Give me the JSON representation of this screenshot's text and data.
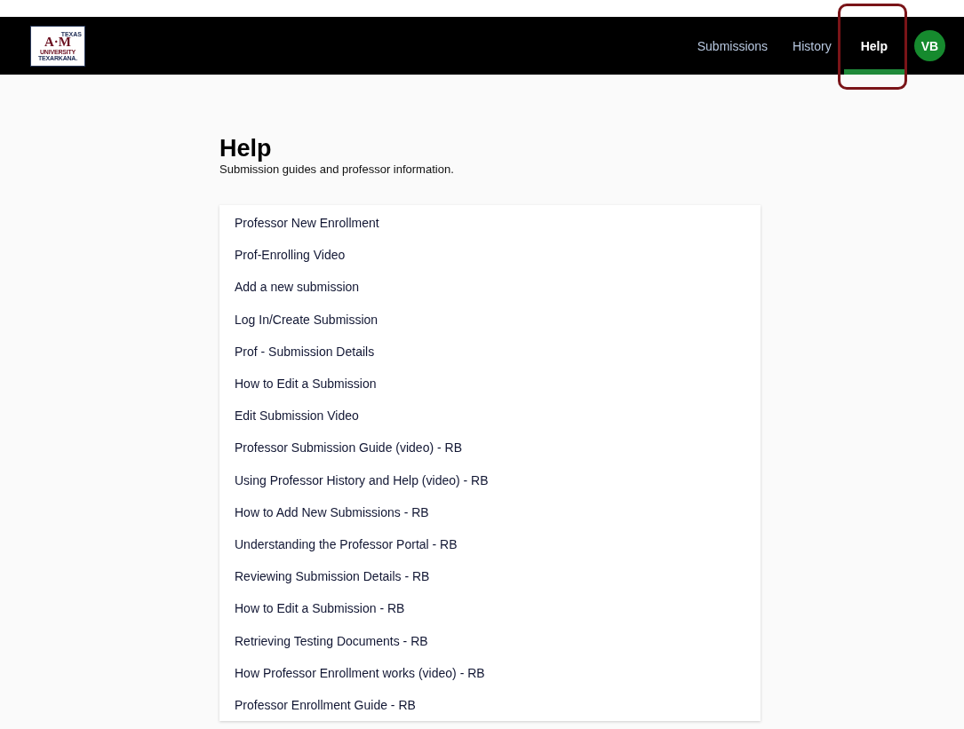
{
  "logo": {
    "top": "TEXAS",
    "mark": "A·M",
    "line1": "UNIVERSITY",
    "line2": "TEXARKANA."
  },
  "nav": [
    {
      "label": "Submissions",
      "selected": false,
      "highlighted": false
    },
    {
      "label": "History",
      "selected": false,
      "highlighted": false
    },
    {
      "label": "Help",
      "selected": true,
      "highlighted": true
    }
  ],
  "avatar": {
    "initials": "VB"
  },
  "page": {
    "title": "Help",
    "subtitle": "Submission guides and professor information."
  },
  "guides": [
    "Professor New Enrollment",
    "Prof-Enrolling Video",
    "Add a new submission",
    "Log In/Create Submission",
    "Prof - Submission Details",
    "How to Edit a Submission",
    "Edit Submission Video",
    "Professor Submission Guide (video) - RB",
    "Using Professor History and Help (video) - RB",
    "How to Add New Submissions - RB",
    "Understanding the Professor Portal - RB",
    "Reviewing Submission Details - RB",
    "How to Edit a Submission - RB",
    "Retrieving Testing Documents - RB",
    "How Professor Enrollment works (video) - RB",
    "Professor Enrollment Guide - RB"
  ]
}
